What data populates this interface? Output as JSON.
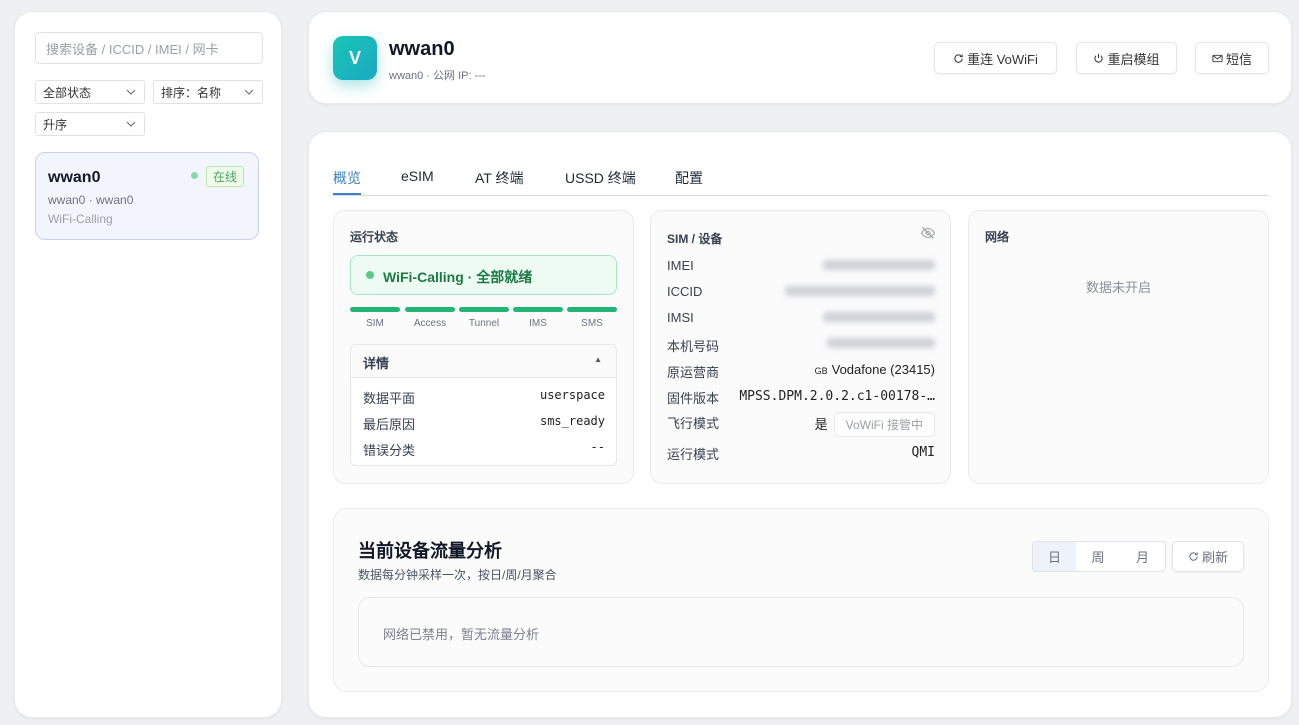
{
  "sidebar": {
    "search_placeholder": "搜索设备 / ICCID / IMEI / 网卡",
    "filter_status": "全部状态",
    "sort_by": "排序：名称",
    "sort_order": "升序",
    "devices": [
      {
        "name": "wwan0",
        "sub": "wwan0 · wwan0",
        "mode": "WiFi-Calling",
        "status": "在线"
      }
    ]
  },
  "header": {
    "avatar_letter": "V",
    "title": "wwan0",
    "subtitle": "wwan0 · 公网 IP: ---",
    "buttons": {
      "reconnect": "重连 VoWiFi",
      "restart": "重启模组",
      "sms": "短信"
    }
  },
  "tabs": [
    "概览",
    "eSIM",
    "AT 终端",
    "USSD 终端",
    "配置"
  ],
  "status_card": {
    "title": "运行状态",
    "ready_text": "WiFi-Calling · 全部就绪",
    "stages": [
      "SIM",
      "Access",
      "Tunnel",
      "IMS",
      "SMS"
    ],
    "details_title": "详情",
    "rows": [
      {
        "label": "数据平面",
        "value": "userspace"
      },
      {
        "label": "最后原因",
        "value": "sms_ready"
      },
      {
        "label": "错误分类",
        "value": "--"
      }
    ]
  },
  "sim_card": {
    "title": "SIM / 设备",
    "rows": [
      {
        "label": "IMEI",
        "value": ""
      },
      {
        "label": "ICCID",
        "value": ""
      },
      {
        "label": "IMSI",
        "value": ""
      },
      {
        "label": "本机号码",
        "value": ""
      }
    ],
    "carrier_label": "原运营商",
    "carrier_flag": "GB",
    "carrier_value": "Vodafone (23415)",
    "firmware_label": "固件版本",
    "firmware_value": "MPSS.DPM.2.0.2.c1-00178-…",
    "airplane_label": "飞行模式",
    "airplane_value": "是",
    "airplane_chip": "VoWiFi 接管中",
    "run_mode_label": "运行模式",
    "run_mode_value": "QMI"
  },
  "network_card": {
    "title": "网络",
    "empty": "数据未开启"
  },
  "traffic": {
    "title": "当前设备流量分析",
    "subtitle": "数据每分钟采样一次，按日/周/月聚合",
    "ranges": [
      "日",
      "周",
      "月"
    ],
    "refresh": "刷新",
    "empty": "网络已禁用，暂无流量分析"
  },
  "colors": {
    "accent": "#3b82c4",
    "ready_green": "#22b573",
    "avatar": "#1ab8bd"
  }
}
